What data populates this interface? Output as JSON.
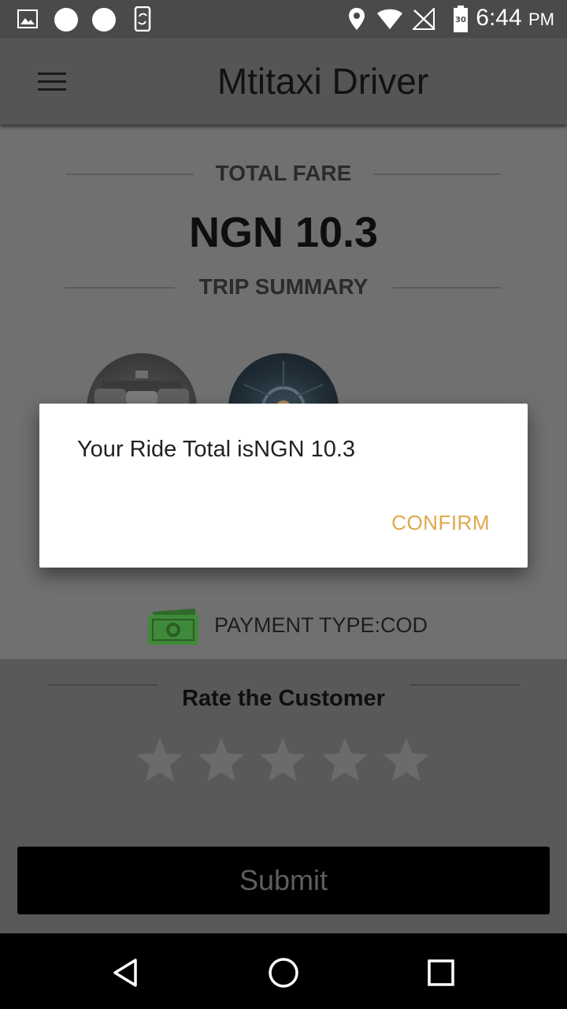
{
  "status_bar": {
    "time": "6:44",
    "ampm": "PM",
    "battery_level": "30",
    "icons": [
      "image-icon",
      "circle-icon",
      "circle-icon",
      "phone-sync-icon",
      "location-icon",
      "wifi-icon",
      "no-signal-icon",
      "battery-icon"
    ]
  },
  "app_bar": {
    "title": "Mtitaxi Driver",
    "menu_icon": "hamburger-menu-icon"
  },
  "trip": {
    "total_fare_label": "TOTAL FARE",
    "fare_amount": "NGN 10.3",
    "summary_label": "TRIP SUMMARY",
    "payment_type": "PAYMENT TYPE:COD"
  },
  "rating": {
    "title": "Rate the Customer",
    "star_count": 5,
    "selected_stars": 0,
    "submit_label": "Submit"
  },
  "dialog": {
    "message": "Your Ride Total isNGN 10.3",
    "confirm_label": "CONFIRM"
  },
  "nav_bar": {
    "icons": [
      "back-icon",
      "home-icon",
      "recents-icon"
    ]
  },
  "colors": {
    "accent": "#e0a84c",
    "overlay_dim": "#707070",
    "app_bar": "#555555"
  }
}
